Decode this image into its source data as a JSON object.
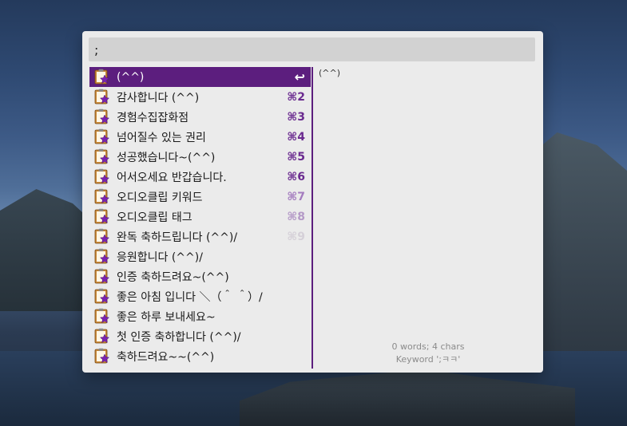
{
  "search": {
    "value": ";"
  },
  "results": [
    {
      "label": "(^^)",
      "shortcut": "↩",
      "selected": true
    },
    {
      "label": "감사합니다 (^^)",
      "shortcut": "⌘2"
    },
    {
      "label": "경험수집잡화점",
      "shortcut": "⌘3"
    },
    {
      "label": "넘어질수 있는 권리",
      "shortcut": "⌘4"
    },
    {
      "label": "성공했습니다~(^^)",
      "shortcut": "⌘5"
    },
    {
      "label": "어서오세요 반갑습니다.",
      "shortcut": "⌘6"
    },
    {
      "label": "오디오클립 키워드",
      "shortcut": "⌘7"
    },
    {
      "label": "오디오클립 태그",
      "shortcut": "⌘8"
    },
    {
      "label": "완독 축하드립니다 (^^)/",
      "shortcut": "⌘9"
    },
    {
      "label": "응원합니다 (^^)/",
      "shortcut": ""
    },
    {
      "label": "인증 축하드려요~(^^)",
      "shortcut": ""
    },
    {
      "label": "좋은 아침 입니다 ＼（＾ ＾）/",
      "shortcut": ""
    },
    {
      "label": "좋은 하루 보내세요~",
      "shortcut": ""
    },
    {
      "label": "첫 인증 축하합니다 (^^)/",
      "shortcut": ""
    },
    {
      "label": "축하드려요~~(^^)",
      "shortcut": ""
    }
  ],
  "preview": {
    "text": "(^^)"
  },
  "footer": {
    "stats": "0 words; 4 chars",
    "keyword": "Keyword ';ㅋㅋ'"
  },
  "icons": {
    "snippet": "snippet-clipboard-star-icon"
  },
  "colors": {
    "accent": "#5c1e7e",
    "search_bg": "#d2d2d2",
    "panel_bg": "#ebebeb"
  }
}
